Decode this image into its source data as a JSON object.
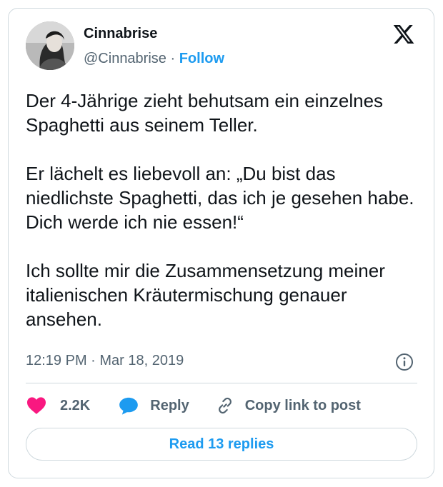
{
  "author": {
    "name": "Cinnabrise",
    "handle": "@Cinnabrise",
    "separator": "·",
    "follow_label": "Follow"
  },
  "tweet": {
    "text": "Der 4-Jährige zieht behutsam ein einzelnes Spaghetti aus seinem Teller.\n\nEr lächelt es liebevoll an: „Du bist das niedlichste Spaghetti, das ich je gesehen habe. Dich werde ich nie essen!“\n\nIch sollte mir die Zusammensetzung meiner italienischen Kräutermischung genauer ansehen.",
    "timestamp": "12:19 PM · Mar 18, 2019"
  },
  "actions": {
    "likes_count": "2.2K",
    "reply_label": "Reply",
    "copy_label": "Copy link to post"
  },
  "read_replies_label": "Read 13 replies",
  "icons": {
    "brand": "x-logo-icon",
    "info": "info-icon",
    "like": "heart-icon",
    "reply": "speech-bubble-icon",
    "copy": "link-icon"
  },
  "colors": {
    "accent": "#1d9bf0",
    "like": "#f91880",
    "text": "#0f1419",
    "muted": "#536471",
    "border": "#cfd9de"
  }
}
